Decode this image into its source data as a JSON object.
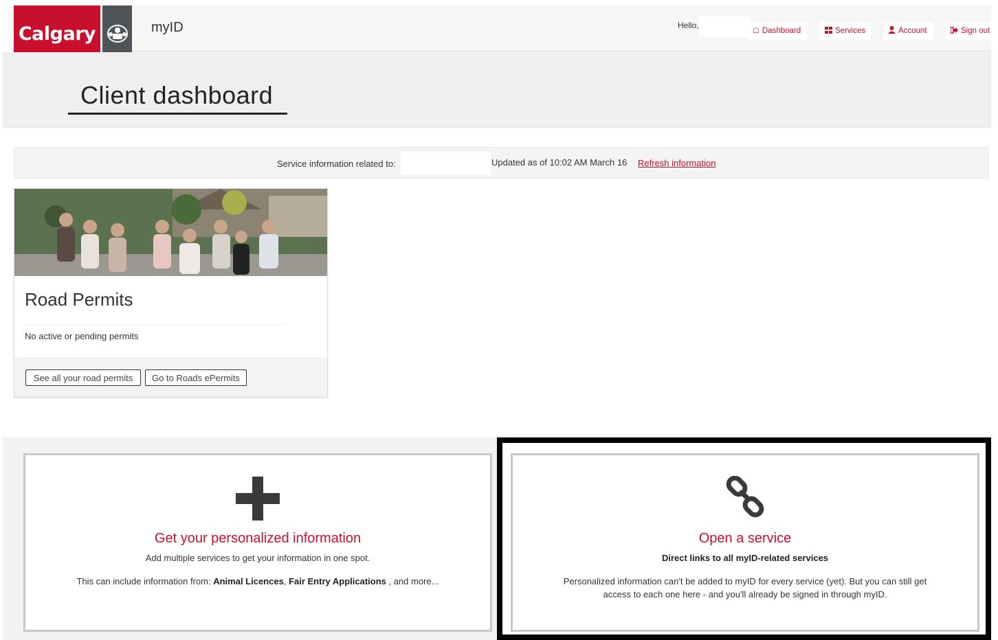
{
  "header": {
    "logo_text": "Calgary",
    "app_name": "myID",
    "greeting": "Hello,",
    "nav": [
      {
        "label": "Dashboard",
        "icon": "home-icon"
      },
      {
        "label": "Services",
        "icon": "grid-icon"
      },
      {
        "label": "Account",
        "icon": "user-icon"
      },
      {
        "label": "Sign out",
        "icon": "sign-out-icon"
      }
    ]
  },
  "page": {
    "title": "Client dashboard"
  },
  "info_bar": {
    "label": "Service information related to:",
    "updated": "Updated as of 10:02 AM March 16",
    "refresh_label": "Refresh information"
  },
  "road_permits": {
    "title": "Road Permits",
    "status": "No active or pending permits",
    "buttons": [
      "See all your road permits",
      "Go to Roads ePermits"
    ]
  },
  "tiles": {
    "personalized": {
      "icon": "plus-icon",
      "heading": "Get your personalized information",
      "subtitle": "Add multiple services to get your information in one spot.",
      "desc_prefix": "This can include information from: ",
      "desc_item1": "Animal Licences",
      "desc_sep": ", ",
      "desc_item2": "Fair Entry Applications",
      "desc_suffix": " , and more..."
    },
    "open_service": {
      "icon": "link-icon",
      "heading": "Open a service",
      "subtitle": "Direct links to all myID-related services",
      "desc_line1": "Personalized information can't be added to myID for every service (yet). But you can still get",
      "desc_line2": "access to each one here - and you'll already be signed in through myID."
    }
  },
  "colors": {
    "brand_red": "#c8102e",
    "crest_gray": "#4f5459",
    "text": "#333333"
  }
}
